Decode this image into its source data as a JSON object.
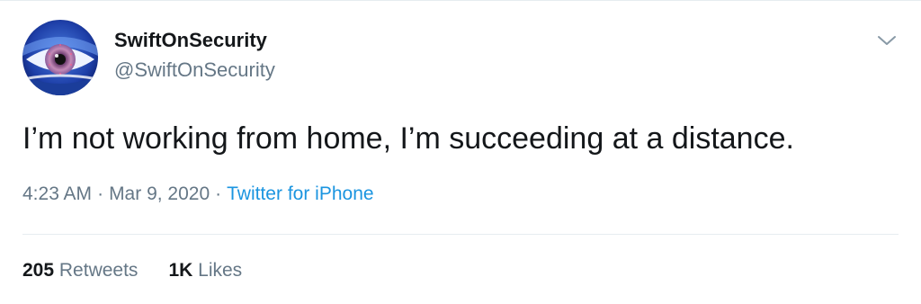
{
  "author": {
    "display_name": "SwiftOnSecurity",
    "handle": "@SwiftOnSecurity",
    "avatar_icon": "eye-avatar"
  },
  "tweet": {
    "text": "I’m not working from home, I’m succeeding at a distance.",
    "time": "4:23 AM",
    "separator": "·",
    "date": "Mar 9, 2020",
    "source": "Twitter for iPhone"
  },
  "stats": {
    "retweets_count": "205",
    "retweets_label": "Retweets",
    "likes_count": "1K",
    "likes_label": "Likes"
  },
  "menu": {
    "caret_icon": "chevron-down-icon"
  },
  "colors": {
    "text": "#14171a",
    "secondary": "#657786",
    "link": "#1b95e0",
    "divider": "#e6ecf0"
  }
}
